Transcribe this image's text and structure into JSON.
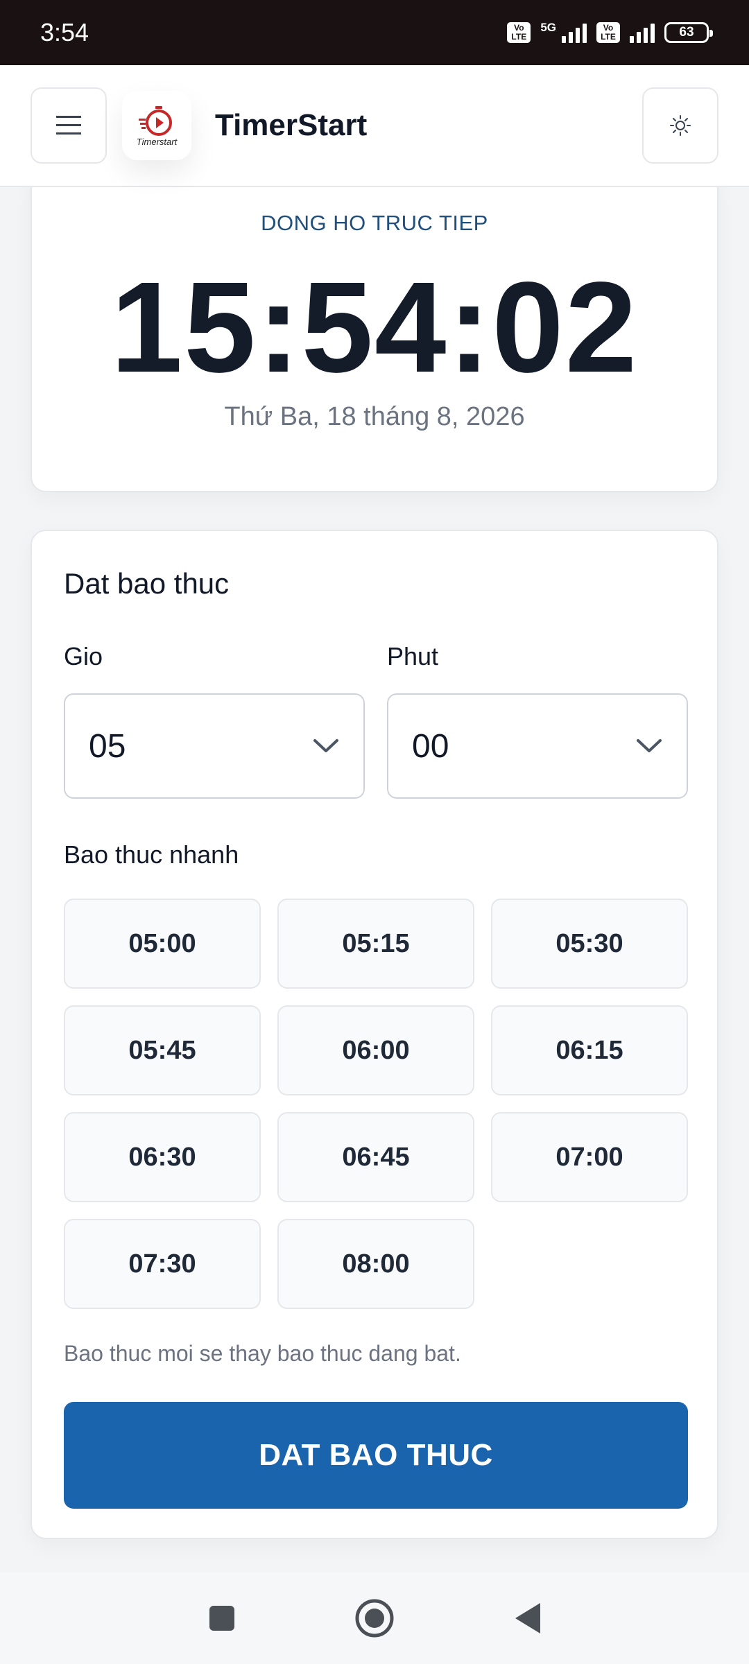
{
  "status_bar": {
    "time": "3:54",
    "volte1": [
      "Vo",
      "LTE"
    ],
    "network": "5G",
    "volte2": [
      "Vo",
      "LTE"
    ],
    "battery": "63"
  },
  "header": {
    "logo_text": "Timerstart",
    "title": "TimerStart",
    "theme_icon": "sun-icon"
  },
  "clock": {
    "label": "DONG HO TRUC TIEP",
    "time": "15:54:02",
    "date": "Thứ Ba, 18 tháng 8, 2026"
  },
  "alarm": {
    "title": "Dat bao thuc",
    "hour_label": "Gio",
    "hour_value": "05",
    "minute_label": "Phut",
    "minute_value": "00",
    "quick_label": "Bao thuc nhanh",
    "quick_times": [
      "05:00",
      "05:15",
      "05:30",
      "05:45",
      "06:00",
      "06:15",
      "06:30",
      "06:45",
      "07:00",
      "07:30",
      "08:00"
    ],
    "hint": "Bao thuc moi se thay bao thuc dang bat.",
    "set_button": "DAT BAO THUC"
  },
  "colors": {
    "primary": "#1a63ad",
    "label_blue": "#1f4f7a"
  }
}
